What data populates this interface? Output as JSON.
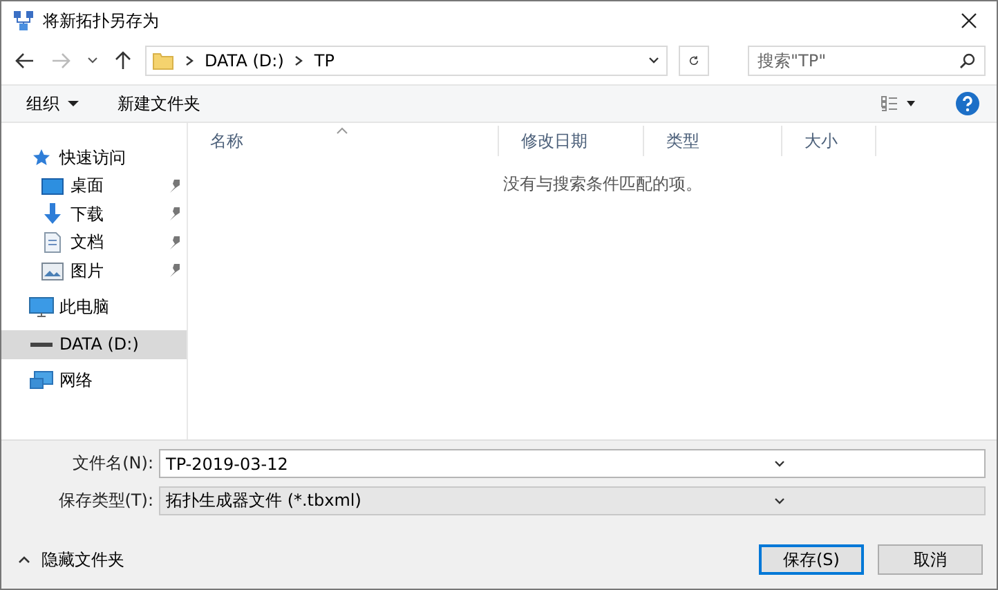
{
  "window": {
    "title": "将新拓扑另存为"
  },
  "address": {
    "path": [
      {
        "label": "DATA (D:)"
      },
      {
        "label": "TP"
      }
    ]
  },
  "search": {
    "placeholder": "搜索\"TP\""
  },
  "toolbar": {
    "organize": "组织",
    "new_folder": "新建文件夹"
  },
  "sidebar": {
    "items": [
      {
        "label": "快速访问",
        "kind": "star",
        "selected": false,
        "children": [
          {
            "label": "桌面",
            "kind": "desktop",
            "selected": false,
            "pinned": true
          },
          {
            "label": "下载",
            "kind": "download",
            "selected": false,
            "pinned": true
          },
          {
            "label": "文档",
            "kind": "document",
            "selected": false,
            "pinned": true
          },
          {
            "label": "图片",
            "kind": "pictures",
            "selected": false,
            "pinned": true
          }
        ]
      },
      {
        "label": "此电脑",
        "kind": "pc",
        "selected": false
      },
      {
        "label": "DATA (D:)",
        "kind": "drive",
        "selected": true
      },
      {
        "label": "网络",
        "kind": "network",
        "selected": false
      }
    ]
  },
  "table": {
    "columns": [
      {
        "label": "名称",
        "sorted": true
      },
      {
        "label": "修改日期",
        "sorted": false
      },
      {
        "label": "类型",
        "sorted": false
      },
      {
        "label": "大小",
        "sorted": false
      }
    ],
    "empty_message": "没有与搜索条件匹配的项。"
  },
  "form": {
    "file_name": {
      "label": "文件名(N):",
      "value": "TP-2019-03-12"
    },
    "file_type": {
      "label": "保存类型(T):",
      "value": "拓扑生成器文件 (*.tbxml)"
    }
  },
  "footer": {
    "toggle": "隐藏文件夹",
    "buttons": [
      {
        "label": "保存(S)",
        "default": true
      },
      {
        "label": "取消",
        "default": false
      }
    ]
  }
}
